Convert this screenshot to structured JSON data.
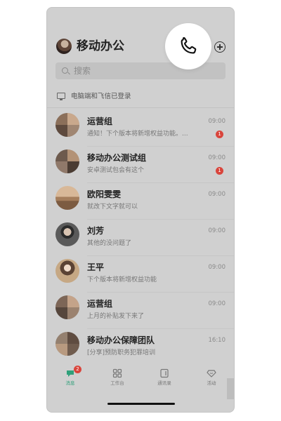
{
  "header": {
    "title": "移动办公"
  },
  "search": {
    "placeholder": "搜索"
  },
  "login_notice": "电脑端和飞信已登录",
  "chats": [
    {
      "name": "运营组",
      "message": "通知！下个版本将新增权益功能。...",
      "time": "09:00",
      "unread": "1",
      "avatar": "group"
    },
    {
      "name": "移动办公测试组",
      "message": "安卓测试包会有这个",
      "time": "09:00",
      "unread": "1",
      "avatar": "group"
    },
    {
      "name": "欧阳雯雯",
      "message": "就改下文字就可以",
      "time": "09:00",
      "unread": "",
      "avatar": "beach"
    },
    {
      "name": "刘芳",
      "message": "其他的没问题了",
      "time": "09:00",
      "unread": "",
      "avatar": "man"
    },
    {
      "name": "王平",
      "message": "下个版本将新增权益功能",
      "time": "09:00",
      "unread": "",
      "avatar": "woman"
    },
    {
      "name": "运营组",
      "message": "上月的补贴发下来了",
      "time": "09:00",
      "unread": "",
      "avatar": "group"
    },
    {
      "name": "移动办公保障团队",
      "message": "[分享]预防职务犯罪培训",
      "time": "16:10",
      "unread": "",
      "avatar": "group"
    }
  ],
  "tabs": [
    {
      "label": "消息",
      "badge": "2",
      "active": true
    },
    {
      "label": "工作台"
    },
    {
      "label": "通讯录"
    },
    {
      "label": "活动"
    }
  ],
  "colors": {
    "accent": "#2fa07a",
    "badge": "#d9453c",
    "overlay": "#d0d0d0"
  },
  "icons": [
    "phone-icon",
    "add-circle-icon",
    "search-icon",
    "computer-icon",
    "message-tab-icon",
    "workbench-tab-icon",
    "contacts-tab-icon",
    "activity-tab-icon"
  ]
}
